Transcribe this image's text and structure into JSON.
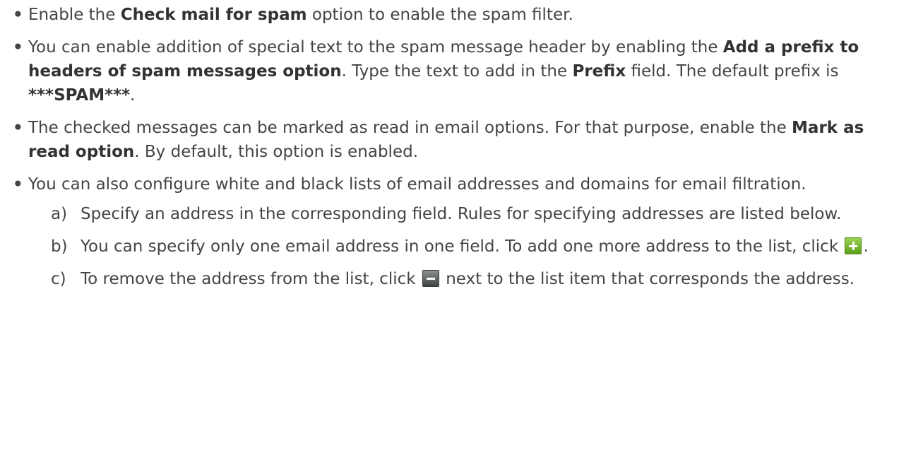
{
  "bullets": [
    {
      "pre": "Enable the ",
      "bold1": "Check mail for spam",
      "post": " option to enable the spam filter."
    },
    {
      "pre": "You can enable addition of special text to the spam message header by enabling the ",
      "bold1": "Add a prefix to headers of spam messages option",
      "mid1": ". Type the text to add in the ",
      "bold2": "Prefix",
      "mid2": " field. The default prefix is ",
      "bold3": "***SPAM***",
      "post": "."
    },
    {
      "pre": "The checked messages can be marked as read in email options. For that purpose, enable the ",
      "bold1": "Mark as read option",
      "post": ". By default, this option is enabled."
    },
    {
      "text": "You can also configure white and black lists of email addresses and domains for email filtra­tion."
    }
  ],
  "steps": [
    {
      "marker": "a)",
      "text": "Specify an address in the corresponding field. Rules for specifying addresses are listed below."
    },
    {
      "marker": "b)",
      "pre": "You can specify only one email address in one field. To add one more address to the list, click ",
      "post": ".",
      "icon": "add-icon"
    },
    {
      "marker": "c)",
      "pre": "To remove the address from the list, click ",
      "post": " next to the list item that corresponds the address.",
      "icon": "remove-icon"
    }
  ],
  "bullet_symbol": "•",
  "colors": {
    "text": "#444444",
    "add_button": "#5aa01c",
    "remove_button": "#3f4545"
  }
}
